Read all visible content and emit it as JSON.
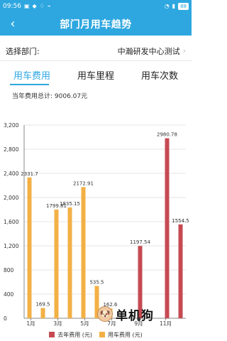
{
  "status": {
    "time": "09:56",
    "battery": "88",
    "colors": {
      "bar": "#2ea7e0"
    }
  },
  "header": {
    "title": "部门月用车趋势",
    "back_icon": "chevron-left-icon"
  },
  "department": {
    "label": "选择部门:",
    "value": "中瀚研发中心测试"
  },
  "tabs": [
    {
      "label": "用车费用",
      "active": true
    },
    {
      "label": "用车里程",
      "active": false
    },
    {
      "label": "用车次数",
      "active": false
    }
  ],
  "summary": {
    "label": "当年费用总计:",
    "value": "9006.07元"
  },
  "chart_data": {
    "type": "bar",
    "ylim": [
      0,
      3200
    ],
    "yticks": [
      "0",
      "400",
      "800",
      "1,200",
      "1,600",
      "2,000",
      "2,400",
      "2,800",
      "3,200"
    ],
    "xticks": [
      "1月",
      "3月",
      "5月",
      "7月",
      "9月",
      "11月"
    ],
    "categories": [
      "1月",
      "2月",
      "3月",
      "4月",
      "5月",
      "6月",
      "7月",
      "8月",
      "9月",
      "10月",
      "11月",
      "12月"
    ],
    "series": [
      {
        "name": "去年费用 (元)",
        "color": "#c64a52",
        "values": [
          0,
          0,
          0,
          0,
          0,
          0,
          0,
          0,
          1197.54,
          0,
          2980.78,
          1554.5
        ],
        "labels": [
          "",
          "",
          "",
          "",
          "",
          "",
          "",
          "",
          "1197.54",
          "",
          "2980.78",
          "1554.5"
        ]
      },
      {
        "name": "用车费用 (元)",
        "color": "#f3b045",
        "values": [
          2331.7,
          169.5,
          1799.81,
          1835.15,
          2172.91,
          535.5,
          162.6,
          0,
          0,
          0,
          0,
          0
        ],
        "labels": [
          "2331.7",
          "169.5",
          "1799.81",
          "1835.15",
          "2172.91",
          "535.5",
          "162.6",
          "",
          "",
          "",
          "",
          ""
        ]
      }
    ]
  },
  "watermark": {
    "text": "单机狗"
  }
}
